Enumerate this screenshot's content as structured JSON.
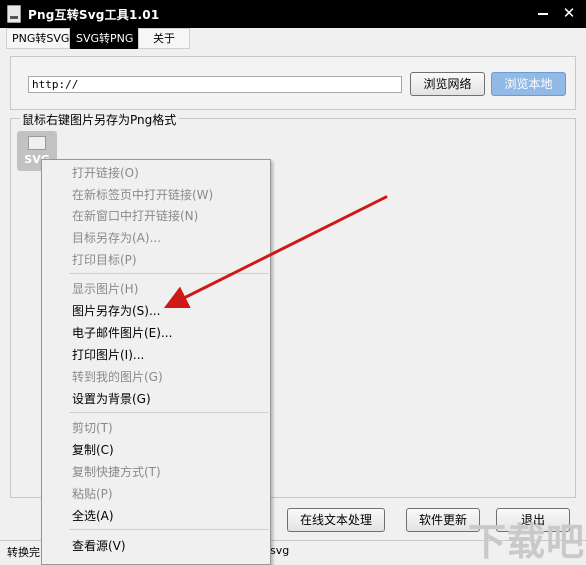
{
  "window": {
    "title": "Png互转Svg工具1.01",
    "close_glyph": "✕"
  },
  "tabs": [
    {
      "label": "PNG转SVG"
    },
    {
      "label": "SVG转PNG"
    },
    {
      "label": "关于"
    }
  ],
  "url_bar": {
    "value": "http://",
    "browse_network": "浏览网络",
    "browse_local": "浏览本地"
  },
  "preview": {
    "label": "鼠标右键图片另存为Png格式",
    "thumb_label": "SVG"
  },
  "context_menu": {
    "items": [
      {
        "label": "打开链接(O)"
      },
      {
        "label": "在新标签页中打开链接(W)"
      },
      {
        "label": "在新窗口中打开链接(N)"
      },
      {
        "label": "目标另存为(A)..."
      },
      {
        "label": "打印目标(P)"
      },
      {
        "label": "显示图片(H)"
      },
      {
        "label": "图片另存为(S)..."
      },
      {
        "label": "电子邮件图片(E)..."
      },
      {
        "label": "打印图片(I)..."
      },
      {
        "label": "转到我的图片(G)"
      },
      {
        "label": "设置为背景(G)"
      },
      {
        "label": "剪切(T)"
      },
      {
        "label": "复制(C)"
      },
      {
        "label": "复制快捷方式(T)"
      },
      {
        "label": "粘贴(P)"
      },
      {
        "label": "全选(A)"
      },
      {
        "label": "查看源(V)"
      }
    ]
  },
  "buttons": {
    "online_text": "在线文本处理",
    "update": "软件更新",
    "exit": "退出"
  },
  "status": {
    "left": "转换完",
    "right": "g .svg"
  },
  "watermark": "下载吧",
  "colors": {
    "accent_button": "#93b9e6",
    "arrow": "#d01818"
  }
}
